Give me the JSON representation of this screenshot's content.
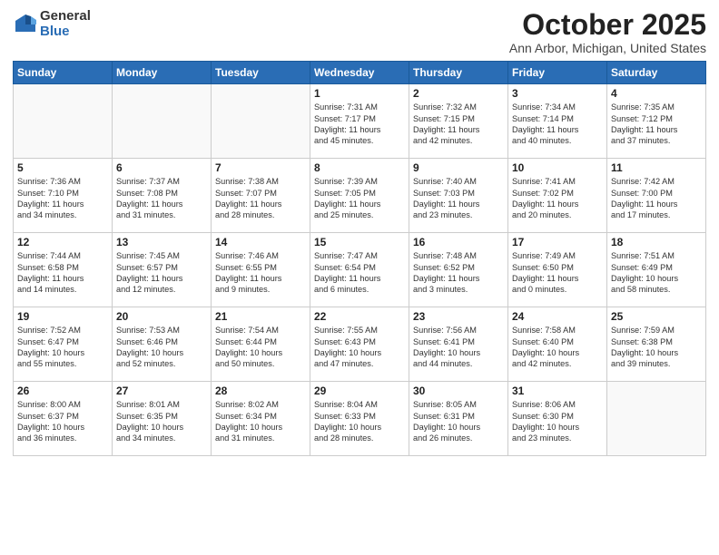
{
  "header": {
    "logo_general": "General",
    "logo_blue": "Blue",
    "month_title": "October 2025",
    "location": "Ann Arbor, Michigan, United States"
  },
  "weekdays": [
    "Sunday",
    "Monday",
    "Tuesday",
    "Wednesday",
    "Thursday",
    "Friday",
    "Saturday"
  ],
  "weeks": [
    [
      {
        "day": "",
        "info": ""
      },
      {
        "day": "",
        "info": ""
      },
      {
        "day": "",
        "info": ""
      },
      {
        "day": "1",
        "info": "Sunrise: 7:31 AM\nSunset: 7:17 PM\nDaylight: 11 hours\nand 45 minutes."
      },
      {
        "day": "2",
        "info": "Sunrise: 7:32 AM\nSunset: 7:15 PM\nDaylight: 11 hours\nand 42 minutes."
      },
      {
        "day": "3",
        "info": "Sunrise: 7:34 AM\nSunset: 7:14 PM\nDaylight: 11 hours\nand 40 minutes."
      },
      {
        "day": "4",
        "info": "Sunrise: 7:35 AM\nSunset: 7:12 PM\nDaylight: 11 hours\nand 37 minutes."
      }
    ],
    [
      {
        "day": "5",
        "info": "Sunrise: 7:36 AM\nSunset: 7:10 PM\nDaylight: 11 hours\nand 34 minutes."
      },
      {
        "day": "6",
        "info": "Sunrise: 7:37 AM\nSunset: 7:08 PM\nDaylight: 11 hours\nand 31 minutes."
      },
      {
        "day": "7",
        "info": "Sunrise: 7:38 AM\nSunset: 7:07 PM\nDaylight: 11 hours\nand 28 minutes."
      },
      {
        "day": "8",
        "info": "Sunrise: 7:39 AM\nSunset: 7:05 PM\nDaylight: 11 hours\nand 25 minutes."
      },
      {
        "day": "9",
        "info": "Sunrise: 7:40 AM\nSunset: 7:03 PM\nDaylight: 11 hours\nand 23 minutes."
      },
      {
        "day": "10",
        "info": "Sunrise: 7:41 AM\nSunset: 7:02 PM\nDaylight: 11 hours\nand 20 minutes."
      },
      {
        "day": "11",
        "info": "Sunrise: 7:42 AM\nSunset: 7:00 PM\nDaylight: 11 hours\nand 17 minutes."
      }
    ],
    [
      {
        "day": "12",
        "info": "Sunrise: 7:44 AM\nSunset: 6:58 PM\nDaylight: 11 hours\nand 14 minutes."
      },
      {
        "day": "13",
        "info": "Sunrise: 7:45 AM\nSunset: 6:57 PM\nDaylight: 11 hours\nand 12 minutes."
      },
      {
        "day": "14",
        "info": "Sunrise: 7:46 AM\nSunset: 6:55 PM\nDaylight: 11 hours\nand 9 minutes."
      },
      {
        "day": "15",
        "info": "Sunrise: 7:47 AM\nSunset: 6:54 PM\nDaylight: 11 hours\nand 6 minutes."
      },
      {
        "day": "16",
        "info": "Sunrise: 7:48 AM\nSunset: 6:52 PM\nDaylight: 11 hours\nand 3 minutes."
      },
      {
        "day": "17",
        "info": "Sunrise: 7:49 AM\nSunset: 6:50 PM\nDaylight: 11 hours\nand 0 minutes."
      },
      {
        "day": "18",
        "info": "Sunrise: 7:51 AM\nSunset: 6:49 PM\nDaylight: 10 hours\nand 58 minutes."
      }
    ],
    [
      {
        "day": "19",
        "info": "Sunrise: 7:52 AM\nSunset: 6:47 PM\nDaylight: 10 hours\nand 55 minutes."
      },
      {
        "day": "20",
        "info": "Sunrise: 7:53 AM\nSunset: 6:46 PM\nDaylight: 10 hours\nand 52 minutes."
      },
      {
        "day": "21",
        "info": "Sunrise: 7:54 AM\nSunset: 6:44 PM\nDaylight: 10 hours\nand 50 minutes."
      },
      {
        "day": "22",
        "info": "Sunrise: 7:55 AM\nSunset: 6:43 PM\nDaylight: 10 hours\nand 47 minutes."
      },
      {
        "day": "23",
        "info": "Sunrise: 7:56 AM\nSunset: 6:41 PM\nDaylight: 10 hours\nand 44 minutes."
      },
      {
        "day": "24",
        "info": "Sunrise: 7:58 AM\nSunset: 6:40 PM\nDaylight: 10 hours\nand 42 minutes."
      },
      {
        "day": "25",
        "info": "Sunrise: 7:59 AM\nSunset: 6:38 PM\nDaylight: 10 hours\nand 39 minutes."
      }
    ],
    [
      {
        "day": "26",
        "info": "Sunrise: 8:00 AM\nSunset: 6:37 PM\nDaylight: 10 hours\nand 36 minutes."
      },
      {
        "day": "27",
        "info": "Sunrise: 8:01 AM\nSunset: 6:35 PM\nDaylight: 10 hours\nand 34 minutes."
      },
      {
        "day": "28",
        "info": "Sunrise: 8:02 AM\nSunset: 6:34 PM\nDaylight: 10 hours\nand 31 minutes."
      },
      {
        "day": "29",
        "info": "Sunrise: 8:04 AM\nSunset: 6:33 PM\nDaylight: 10 hours\nand 28 minutes."
      },
      {
        "day": "30",
        "info": "Sunrise: 8:05 AM\nSunset: 6:31 PM\nDaylight: 10 hours\nand 26 minutes."
      },
      {
        "day": "31",
        "info": "Sunrise: 8:06 AM\nSunset: 6:30 PM\nDaylight: 10 hours\nand 23 minutes."
      },
      {
        "day": "",
        "info": ""
      }
    ]
  ]
}
